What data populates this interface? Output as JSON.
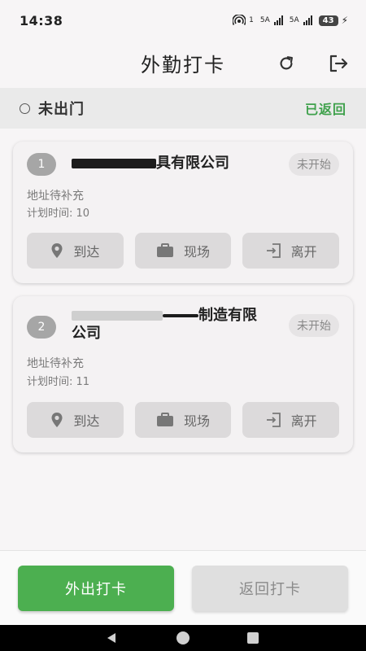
{
  "status_bar": {
    "time": "14:38",
    "net1": "1",
    "sig1": "5A",
    "sig2": "5A",
    "battery": "43"
  },
  "header": {
    "title": "外勤打卡"
  },
  "status": {
    "current": "未出门",
    "returned_label": "已返回"
  },
  "tasks": [
    {
      "index": "1",
      "name_suffix": "具有限公司",
      "state": "未开始",
      "address": "地址待补充",
      "plan_time": "计划时间: 10"
    },
    {
      "index": "2",
      "name_suffix": "制造有限",
      "name_line2": "公司",
      "state": "未开始",
      "address": "地址待补充",
      "plan_time": "计划时间: 11"
    }
  ],
  "actions": {
    "arrive": "到达",
    "onsite": "现场",
    "leave": "离开"
  },
  "bottom": {
    "go_out": "外出打卡",
    "return": "返回打卡"
  },
  "colors": {
    "accent_green": "#4caf50",
    "returned_green": "#3fa14c"
  }
}
